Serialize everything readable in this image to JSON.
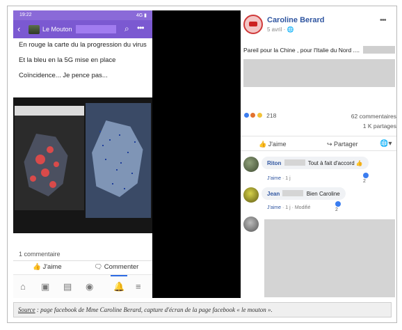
{
  "phone": {
    "status_time": "19:22",
    "status_signal": "4G",
    "group_name": "Le Mouton",
    "post_lines": [
      "En rouge la carte du la progression du virus",
      "Et la bleu en la 5G mise en place",
      "Coïncidence... Je pence pas..."
    ],
    "comments_count": "1 commentaire",
    "like_label": "J'aime",
    "comment_label": "Commenter",
    "accent": "#7b59d1"
  },
  "fb_post": {
    "author": "Caroline Berard",
    "date": "5 avril · ",
    "text": "Pareil pour la Chine , pour l'Italie du Nord ....",
    "reaction_count": "218",
    "comment_count": "62 commentaires",
    "share_count": "1 K partages",
    "like_label": "J'aime",
    "share_label": "Partager",
    "name_color": "#2f55a0"
  },
  "comments": [
    {
      "name": "Riton",
      "text": "Tout à fait d'accord ",
      "like": "J'aime",
      "time": " · 1 j",
      "reactions": "2"
    },
    {
      "name": "Jean",
      "text": "Bien Caroline",
      "like": "J'aime",
      "time": " · 1 j · Modifié",
      "reactions": "2"
    }
  ],
  "caption": {
    "source_label": "Source",
    "text": " : page facebook de Mme Caroline Berard, capture d'écran de la page facebook « le mouton »."
  }
}
